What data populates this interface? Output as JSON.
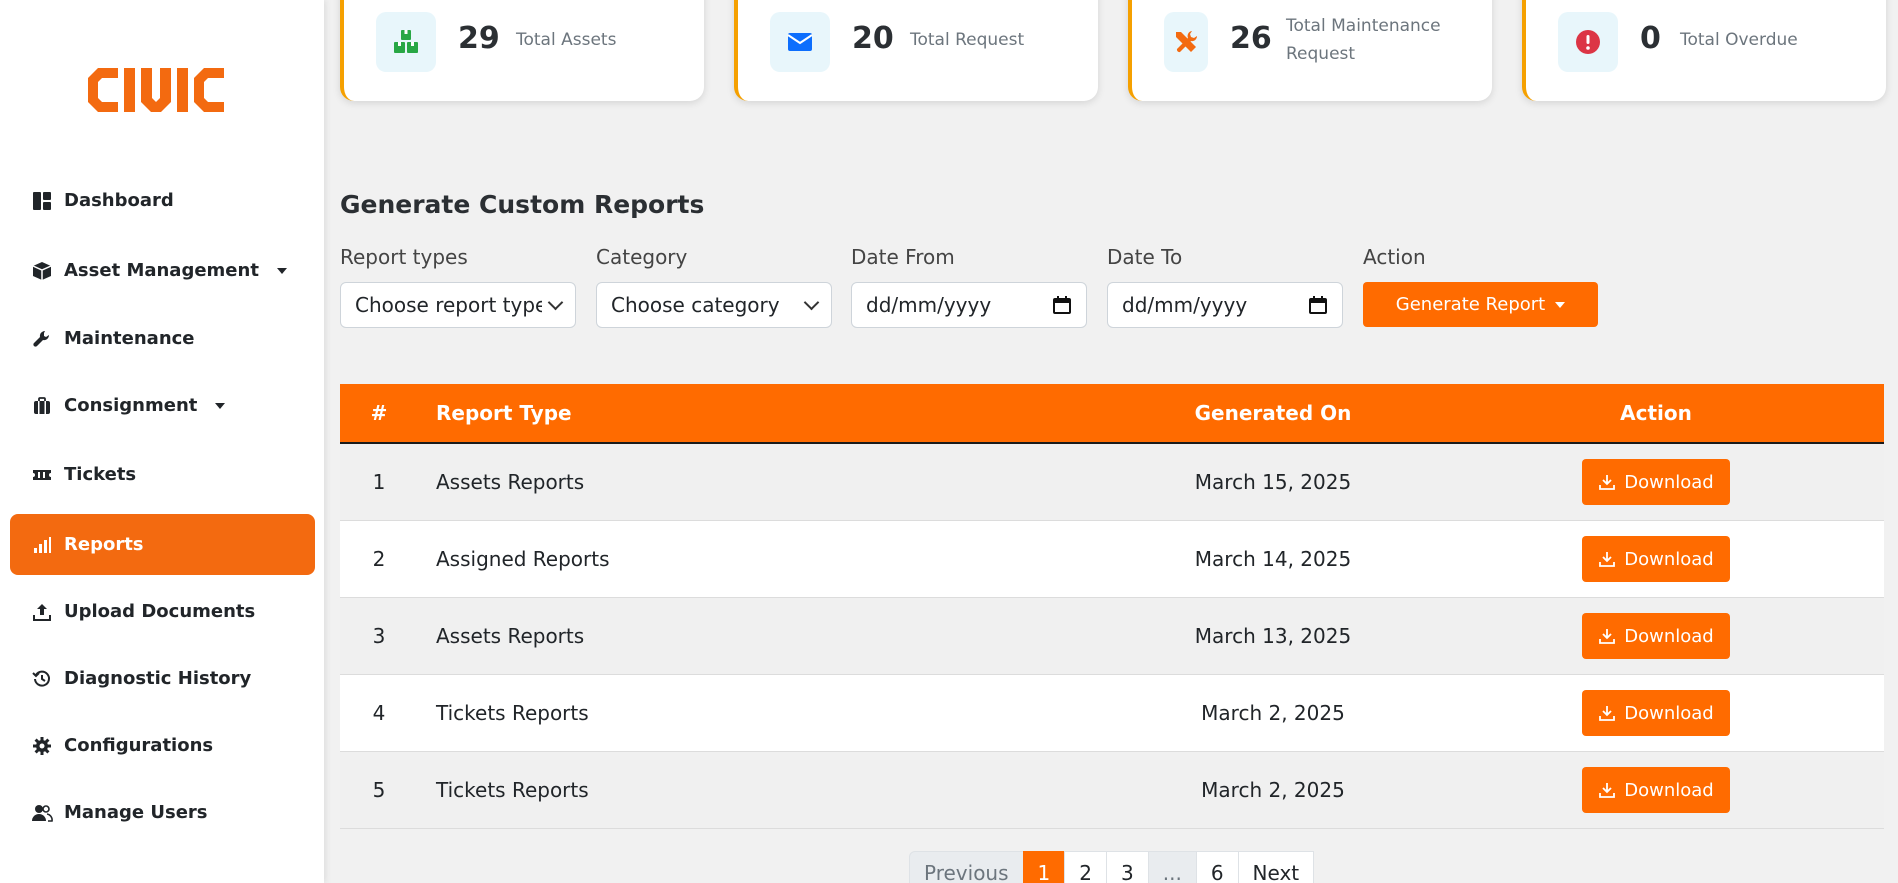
{
  "brand": {
    "logo_text": "CIVIC",
    "accent_color": "#ff6b00"
  },
  "sidebar": {
    "items": [
      {
        "label": "Dashboard",
        "icon": "dashboard-icon"
      },
      {
        "label": "Asset Management",
        "icon": "box-icon",
        "has_caret": true
      },
      {
        "label": "Maintenance",
        "icon": "wrench-icon"
      },
      {
        "label": "Consignment",
        "icon": "briefcase-icon",
        "has_caret": true
      },
      {
        "label": "Tickets",
        "icon": "ticket-icon"
      },
      {
        "label": "Reports",
        "icon": "bar-chart-icon",
        "active": true
      },
      {
        "label": "Upload Documents",
        "icon": "upload-icon"
      },
      {
        "label": "Diagnostic History",
        "icon": "history-icon"
      },
      {
        "label": "Configurations",
        "icon": "gear-icon"
      },
      {
        "label": "Manage Users",
        "icon": "users-icon"
      }
    ]
  },
  "stats": [
    {
      "value": "29",
      "label": "Total Assets",
      "icon": "boxes-icon",
      "icon_color": "#28a745"
    },
    {
      "value": "20",
      "label": "Total Request",
      "icon": "envelope-icon",
      "icon_color": "#0d6efd"
    },
    {
      "value": "26",
      "label": "Total Maintenance Request",
      "icon": "tools-icon",
      "icon_color": "#f36a10"
    },
    {
      "value": "0",
      "label": "Total Overdue",
      "icon": "alert-icon",
      "icon_color": "#dc3545"
    }
  ],
  "reports_section": {
    "title": "Generate Custom Reports",
    "filters": {
      "report_types_label": "Report types",
      "report_types_value": "Choose report type",
      "category_label": "Category",
      "category_value": "Choose category",
      "date_from_label": "Date From",
      "date_from_placeholder": "dd/mm/yyyy",
      "date_to_label": "Date To",
      "date_to_placeholder": "dd/mm/yyyy",
      "action_label": "Action",
      "generate_button": "Generate Report"
    }
  },
  "table": {
    "headers": [
      "#",
      "Report Type",
      "Generated On",
      "Action"
    ],
    "rows": [
      {
        "num": "1",
        "type": "Assets Reports",
        "date": "March 15, 2025",
        "action": "Download"
      },
      {
        "num": "2",
        "type": "Assigned Reports",
        "date": "March 14, 2025",
        "action": "Download"
      },
      {
        "num": "3",
        "type": "Assets Reports",
        "date": "March 13, 2025",
        "action": "Download"
      },
      {
        "num": "4",
        "type": "Tickets Reports",
        "date": "March 2, 2025",
        "action": "Download"
      },
      {
        "num": "5",
        "type": "Tickets Reports",
        "date": "March 2, 2025",
        "action": "Download"
      }
    ]
  },
  "pagination": {
    "previous": "Previous",
    "pages": [
      "1",
      "2",
      "3",
      "...",
      "6"
    ],
    "current": "1",
    "next": "Next"
  }
}
